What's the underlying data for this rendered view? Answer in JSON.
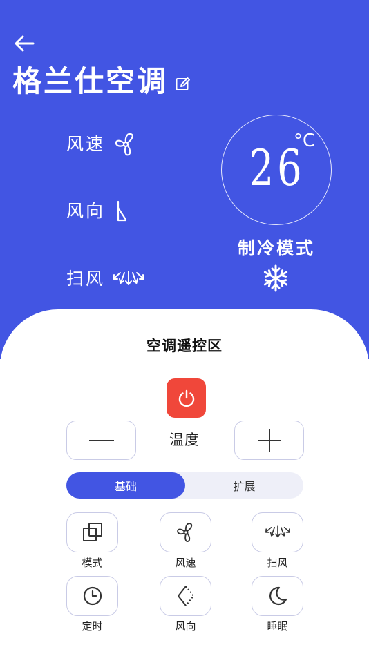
{
  "header": {
    "title": "格兰仕空调",
    "back_icon": "arrow-left-icon",
    "edit_icon": "edit-icon"
  },
  "status": {
    "fan_speed_label": "风速",
    "fan_direction_label": "风向",
    "swing_label": "扫风",
    "temperature": "26",
    "unit": "°C",
    "mode": "制冷模式",
    "mode_icon": "snowflake-icon"
  },
  "panel": {
    "title": "空调遥控区",
    "power_icon": "power-icon",
    "temp_label": "温度",
    "minus_icon": "minus-icon",
    "plus_icon": "plus-icon",
    "tabs": [
      {
        "label": "基础",
        "active": true
      },
      {
        "label": "扩展",
        "active": false
      }
    ],
    "functions": [
      {
        "label": "模式",
        "icon": "mode-icon"
      },
      {
        "label": "风速",
        "icon": "fan-icon"
      },
      {
        "label": "扫风",
        "icon": "swing-icon"
      },
      {
        "label": "定时",
        "icon": "clock-icon"
      },
      {
        "label": "风向",
        "icon": "direction-icon"
      },
      {
        "label": "睡眠",
        "icon": "moon-icon"
      }
    ]
  },
  "colors": {
    "primary": "#4255e3",
    "power": "#f0473a",
    "border": "#c9cbe6",
    "tab_bg": "#eeeff8"
  }
}
